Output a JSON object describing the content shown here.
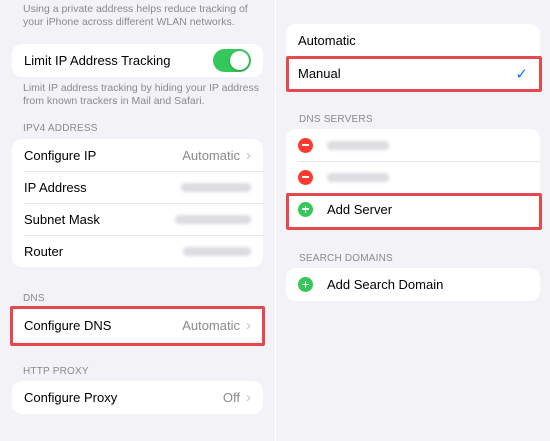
{
  "left": {
    "private_address_note": "Using a private address helps reduce tracking of your iPhone across different WLAN networks.",
    "limit_ip": {
      "label": "Limit IP Address Tracking",
      "enabled": true
    },
    "limit_ip_note": "Limit IP address tracking by hiding your IP address from known trackers in Mail and Safari.",
    "ipv4_header": "IPV4 ADDRESS",
    "ipv4_rows": {
      "configure_ip": {
        "label": "Configure IP",
        "value": "Automatic"
      },
      "ip_address": {
        "label": "IP Address"
      },
      "subnet_mask": {
        "label": "Subnet Mask"
      },
      "router": {
        "label": "Router"
      }
    },
    "dns_header": "DNS",
    "configure_dns": {
      "label": "Configure DNS",
      "value": "Automatic"
    },
    "proxy_header": "HTTP PROXY",
    "configure_proxy": {
      "label": "Configure Proxy",
      "value": "Off"
    }
  },
  "right": {
    "mode_options": {
      "automatic": "Automatic",
      "manual": "Manual",
      "selected": "Manual"
    },
    "dns_servers_header": "DNS SERVERS",
    "add_server": "Add Server",
    "search_domains_header": "SEARCH DOMAINS",
    "add_search_domain": "Add Search Domain"
  },
  "icons": {
    "chevron": "chevron-right-icon",
    "checkmark": "checkmark-icon",
    "remove": "remove-circle-icon",
    "add": "add-circle-icon"
  },
  "colors": {
    "background": "#f2f2f7",
    "card": "#ffffff",
    "toggle_on": "#34c759",
    "accent": "#007aff",
    "remove": "#ff3b30",
    "highlight": "#e5484d"
  }
}
